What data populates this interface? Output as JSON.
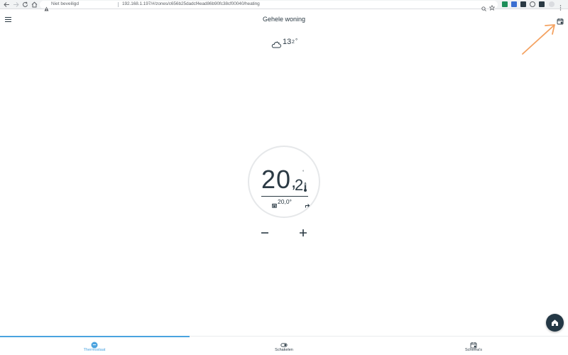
{
  "browser": {
    "security_label": "Niet beveiligd",
    "url": "192.168.1.197/#/zones/c656b25dadcf4ead86b90fc38cf00040/heating"
  },
  "header": {
    "title": "Gehele woning"
  },
  "weather": {
    "icon": "cloud-sun-icon",
    "temp_int": "13",
    "temp_dec": "2",
    "temp_unit": "°"
  },
  "thermostat": {
    "current_int": "20",
    "current_sep": ",",
    "current_dec": "2",
    "current_unit": "°",
    "setpoint": "20,0°"
  },
  "tabs": [
    {
      "label": "Thermostaat",
      "icon": "thermostat-icon",
      "active": true
    },
    {
      "label": "Schakelen",
      "icon": "switch-icon",
      "active": false
    },
    {
      "label": "Schema's",
      "icon": "calendar-icon",
      "active": false
    }
  ],
  "colors": {
    "accent": "#4aa3df",
    "text": "#2b3a44",
    "fab": "#243845",
    "annotation": "#f4a261"
  }
}
